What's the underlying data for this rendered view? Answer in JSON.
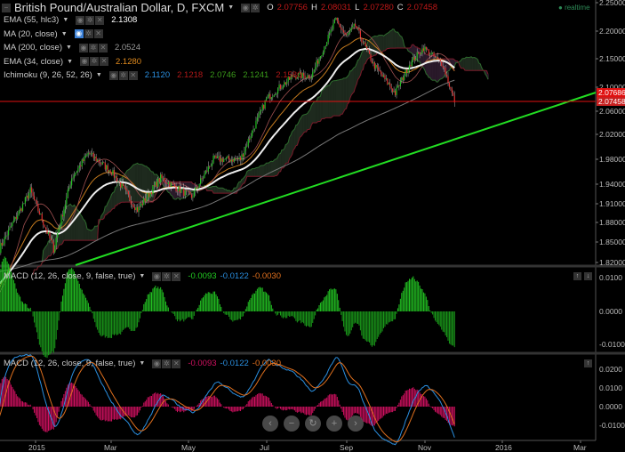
{
  "header": {
    "title": "British Pound/Australian Dollar, D, FXCM",
    "ohlc": [
      {
        "k": "O",
        "v": "2.07756"
      },
      {
        "k": "H",
        "v": "2.08031"
      },
      {
        "k": "L",
        "v": "2.07280"
      },
      {
        "k": "C",
        "v": "2.07458"
      }
    ],
    "realtime": "realtime"
  },
  "indicators": [
    {
      "label": "EMA (55, hlc3)",
      "values": [
        {
          "v": "2.1308",
          "c": "#ffffff"
        }
      ],
      "color": "#ffffff"
    },
    {
      "label": "MA (20, close)",
      "values": [],
      "active": true
    },
    {
      "label": "MA (200, close)",
      "values": [
        {
          "v": "2.0524",
          "c": "#999999"
        }
      ]
    },
    {
      "label": "EMA (34, close)",
      "values": [
        {
          "v": "2.1280",
          "c": "#e08a1e"
        }
      ]
    },
    {
      "label": "Ichimoku (9, 26, 52, 26)",
      "values": [
        {
          "v": "2.1120",
          "c": "#2a8fe0"
        },
        {
          "v": "2.1218",
          "c": "#b01818"
        },
        {
          "v": "2.0746",
          "c": "#3a9a1a"
        },
        {
          "v": "2.1241",
          "c": "#3a9a1a"
        },
        {
          "v": "2.1580",
          "c": "#b01818"
        }
      ]
    }
  ],
  "price_axis": [
    "2.25000",
    "2.20000",
    "2.15000",
    "2.10000",
    "2.06000",
    "2.02000",
    "1.98000",
    "1.94000",
    "1.91000",
    "1.88000",
    "1.85000",
    "1.82000"
  ],
  "price_tags": [
    {
      "v": "2.07686",
      "c": "#e01010"
    },
    {
      "v": "2.07458",
      "c": "#c82020"
    }
  ],
  "macd1": {
    "label": "MACD (12, 26, close, 9, false, true)",
    "values": [
      {
        "v": "-0.0093",
        "c": "#22cc22"
      },
      {
        "v": "-0.0122",
        "c": "#2a8fe0"
      },
      {
        "v": "-0.0030",
        "c": "#e0701e"
      }
    ],
    "axis": [
      "0.0100",
      "0.0000",
      "-0.0100"
    ]
  },
  "macd2": {
    "label": "MACD (12, 26, close, 9, false, true)",
    "values": [
      {
        "v": "-0.0093",
        "c": "#d01060"
      },
      {
        "v": "-0.0122",
        "c": "#2a8fe0"
      },
      {
        "v": "-0.0030",
        "c": "#e0701e"
      }
    ],
    "axis": [
      "0.0200",
      "0.0100",
      "0.0000",
      "-0.0100"
    ]
  },
  "time_axis": [
    "2015",
    "Mar",
    "May",
    "Jul",
    "Sep",
    "Nov",
    "2016",
    "Mar"
  ],
  "nav": {
    "left": "‹",
    "zoom_out": "−",
    "reset": "↻",
    "zoom_in": "+",
    "right": "›"
  },
  "chart_data": {
    "type": "candlestick",
    "title": "British Pound/Australian Dollar, D, FXCM",
    "keypoints_day_price": [
      [
        -28,
        1.84
      ],
      [
        -4,
        1.93
      ],
      [
        14,
        1.84
      ],
      [
        28,
        1.95
      ],
      [
        41,
        1.99
      ],
      [
        59,
        1.96
      ],
      [
        79,
        1.9
      ],
      [
        97,
        1.95
      ],
      [
        121,
        1.92
      ],
      [
        138,
        1.98
      ],
      [
        159,
        1.98
      ],
      [
        179,
        2.08
      ],
      [
        200,
        2.12
      ],
      [
        214,
        2.12
      ],
      [
        233,
        2.22
      ],
      [
        241,
        2.19
      ],
      [
        248,
        2.21
      ],
      [
        262,
        2.14
      ],
      [
        279,
        2.09
      ],
      [
        290,
        2.14
      ],
      [
        301,
        2.17
      ],
      [
        316,
        2.14
      ],
      [
        325,
        2.0746
      ]
    ],
    "trendline": [
      [
        31,
        1.82
      ],
      [
        434,
        2.078
      ]
    ],
    "hline": 2.0746
  }
}
